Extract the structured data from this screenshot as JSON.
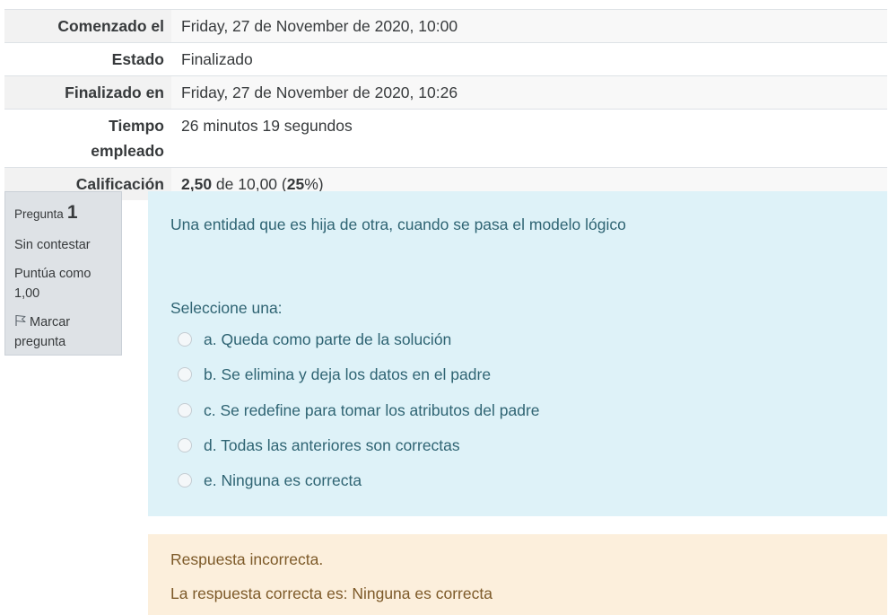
{
  "summary": {
    "rows": [
      {
        "label": "Comenzado el",
        "value": "Friday, 27 de November de 2020, 10:00"
      },
      {
        "label": "Estado",
        "value": "Finalizado"
      },
      {
        "label": "Finalizado en",
        "value": "Friday, 27 de November de 2020, 10:26"
      },
      {
        "label": "Tiempo empleado",
        "value": "26 minutos 19 segundos"
      },
      {
        "label": "Calificación",
        "value_bold": "2,50",
        "value_mid": " de 10,00 (",
        "value_pct": "25",
        "value_end": "%)"
      }
    ]
  },
  "question": {
    "number_label": "Pregunta",
    "number": "1",
    "state": "Sin contestar",
    "grade": "Puntúa como 1,00",
    "flag_label": "Marcar pregunta",
    "text": "Una entidad que es hija de otra, cuando se pasa el modelo lógico",
    "prompt": "Seleccione una:",
    "answers": [
      "a. Queda como parte de la solución",
      "b. Se elimina y deja los datos en el padre",
      "c. Se redefine para tomar los atributos del padre",
      "d. Todas las anteriores son correctas",
      "e. Ninguna es correcta"
    ]
  },
  "feedback": {
    "result": "Respuesta incorrecta.",
    "right_answer": "La respuesta correcta es: Ninguna es correcta"
  },
  "colors": {
    "content_bg": "#def2f8",
    "info_bg": "#dee2e6",
    "feedback_bg": "#fcefdc"
  }
}
